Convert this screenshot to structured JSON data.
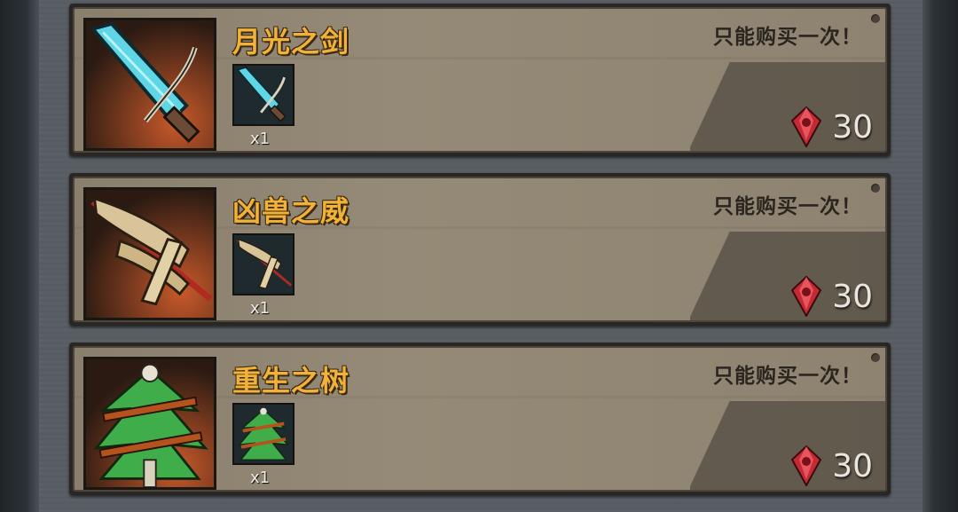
{
  "items": [
    {
      "name": "月光之剑",
      "limit_note": "只能购买一次！",
      "quantity": "x1",
      "price": "30",
      "icon": "crystal-sword-icon",
      "currency_icon": "red-gem-icon"
    },
    {
      "name": "凶兽之威",
      "limit_note": "只能购买一次！",
      "quantity": "x1",
      "price": "30",
      "icon": "feather-spear-icon",
      "currency_icon": "red-gem-icon"
    },
    {
      "name": "重生之树",
      "limit_note": "只能购买一次！",
      "quantity": "x1",
      "price": "30",
      "icon": "skull-tree-icon",
      "currency_icon": "red-gem-icon"
    }
  ]
}
